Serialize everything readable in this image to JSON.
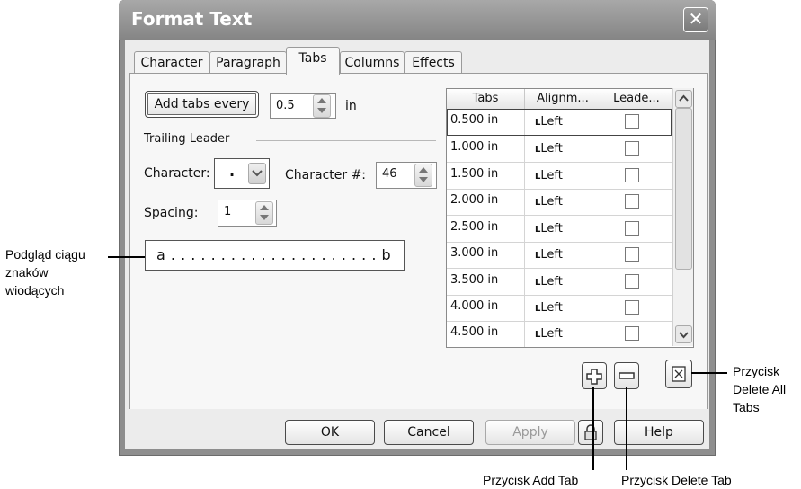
{
  "dialog": {
    "title": "Format Text",
    "close_glyph": "✕"
  },
  "tabs": [
    {
      "label": "Character"
    },
    {
      "label": "Paragraph"
    },
    {
      "label": "Tabs"
    },
    {
      "label": "Columns"
    },
    {
      "label": "Effects"
    }
  ],
  "tabs_panel": {
    "add_tabs_every_label": "Add tabs every",
    "add_tabs_every_value": "0.5",
    "add_tabs_every_unit": "in",
    "trailing_leader_label": "Trailing Leader",
    "character_label": "Character:",
    "character_value": ".",
    "character_num_label": "Character #:",
    "character_num_value": "46",
    "spacing_label": "Spacing:",
    "spacing_value": "1",
    "preview_text": "a . . . . . . . . . . . . . . . . . . . . . b"
  },
  "grid": {
    "headers": [
      "Tabs",
      "Alignm...",
      "Leade..."
    ],
    "rows": [
      {
        "tab": "0.500 in",
        "align": "Left",
        "leader": false
      },
      {
        "tab": "1.000 in",
        "align": "Left",
        "leader": false
      },
      {
        "tab": "1.500 in",
        "align": "Left",
        "leader": false
      },
      {
        "tab": "2.000 in",
        "align": "Left",
        "leader": false
      },
      {
        "tab": "2.500 in",
        "align": "Left",
        "leader": false
      },
      {
        "tab": "3.000 in",
        "align": "Left",
        "leader": false
      },
      {
        "tab": "3.500 in",
        "align": "Left",
        "leader": false
      },
      {
        "tab": "4.000 in",
        "align": "Left",
        "leader": false
      },
      {
        "tab": "4.500 in",
        "align": "Left",
        "leader": false
      }
    ],
    "align_glyph": "L"
  },
  "buttons": {
    "ok": "OK",
    "cancel": "Cancel",
    "apply": "Apply",
    "help": "Help"
  },
  "callouts": {
    "preview": [
      "Podgląd ciągu",
      "znaków",
      "wiodących"
    ],
    "delete_all": [
      "Przycisk",
      "Delete All",
      "Tabs"
    ],
    "add_tab": "Przycisk Add Tab",
    "delete_tab": "Przycisk Delete Tab"
  }
}
